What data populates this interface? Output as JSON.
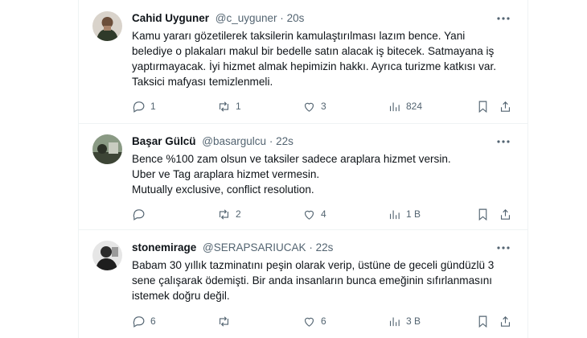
{
  "tweets": [
    {
      "name": "Cahid Uyguner",
      "handle": "@c_uyguner",
      "dot": "·",
      "time": "20s",
      "lines": [
        "Kamu yararı gözetilerek taksilerin kamulaştırılması lazım bence. Yani",
        "belediye o plakaları makul bir bedelle satın alacak iş bitecek. Satmayana iş",
        "yaptırmayacak. İyi hizmet almak hepimizin hakkı. Ayrıca turizme katkısı var.",
        "Taksici mafyası temizlenmeli."
      ],
      "replies": "1",
      "retweets": "1",
      "likes": "3",
      "views": "824",
      "avatar_color": "#7a6a58"
    },
    {
      "name": "Başar Gülcü",
      "handle": "@basargulcu",
      "dot": "·",
      "time": "22s",
      "lines": [
        "Bence %100 zam olsun ve taksiler sadece araplara hizmet versin.",
        "Uber ve Tag araplara hizmet vermesin.",
        "Mutually exclusive, conflict resolution."
      ],
      "replies": "",
      "retweets": "2",
      "likes": "4",
      "views": "1 B",
      "avatar_color": "#56604c"
    },
    {
      "name": "stonemirage",
      "handle": "@SERAPSARIUCAK",
      "dot": "·",
      "time": "22s",
      "lines": [
        "Babam 30 yıllık tazminatını peşin olarak verip, üstüne de geceli gündüzlü 3",
        "sene çalışarak ödemişti. Bir anda insanların bunca emeğinin sıfırlanmasını",
        "istemek doğru değil."
      ],
      "replies": "6",
      "retweets": "",
      "likes": "6",
      "views": "3 B",
      "avatar_color": "#3a3a3a"
    }
  ],
  "colors": {
    "text": "#0f1419",
    "secondary": "#536471",
    "border": "#eff3f4"
  },
  "icons": [
    "reply-icon",
    "retweet-icon",
    "like-icon",
    "views-icon",
    "bookmark-icon",
    "share-icon",
    "more-icon"
  ]
}
